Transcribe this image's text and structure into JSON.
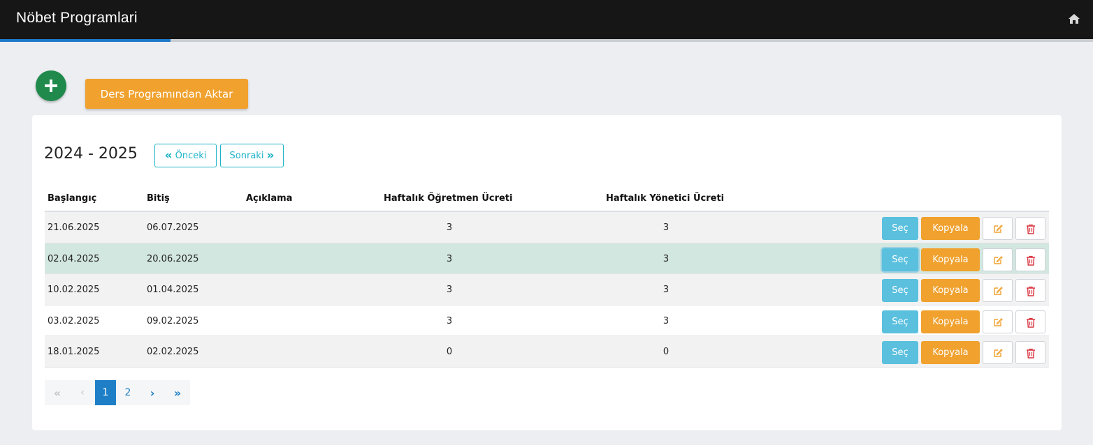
{
  "header": {
    "title": "Nöbet Programlari",
    "home_icon": "home-icon",
    "progress_fraction": 0.156
  },
  "actions": {
    "add_icon": "plus-icon",
    "import_label": "Ders Programından Aktar"
  },
  "panel": {
    "year": "2024 - 2025",
    "prev_label": "Önceki",
    "next_label": "Sonraki"
  },
  "table": {
    "columns": [
      "Başlangıç",
      "Bitiş",
      "Açıklama",
      "Haftalık Öğretmen Ücreti",
      "Haftalık Yönetici Ücreti"
    ],
    "rows": [
      {
        "start": "21.06.2025",
        "end": "06.07.2025",
        "desc": "",
        "teacher_fee": "3",
        "admin_fee": "3"
      },
      {
        "start": "02.04.2025",
        "end": "20.06.2025",
        "desc": "",
        "teacher_fee": "3",
        "admin_fee": "3"
      },
      {
        "start": "10.02.2025",
        "end": "01.04.2025",
        "desc": "",
        "teacher_fee": "3",
        "admin_fee": "3"
      },
      {
        "start": "03.02.2025",
        "end": "09.02.2025",
        "desc": "",
        "teacher_fee": "3",
        "admin_fee": "3"
      },
      {
        "start": "18.01.2025",
        "end": "02.02.2025",
        "desc": "",
        "teacher_fee": "0",
        "admin_fee": "0"
      }
    ],
    "selected_row": 1,
    "select_label": "Seç",
    "copy_label": "Kopyala",
    "edit_icon": "edit-icon",
    "delete_icon": "trash-icon"
  },
  "pagination": {
    "pages": [
      "1",
      "2"
    ],
    "current": "1"
  },
  "colors": {
    "topbar": "#161616",
    "success": "#1f8a4c",
    "warning": "#f0a12e",
    "info": "#5bc0de",
    "outline": "#1fb3c9",
    "primary": "#1e7fc6",
    "selected_row": "#d2e7df",
    "danger": "#d9343f"
  }
}
